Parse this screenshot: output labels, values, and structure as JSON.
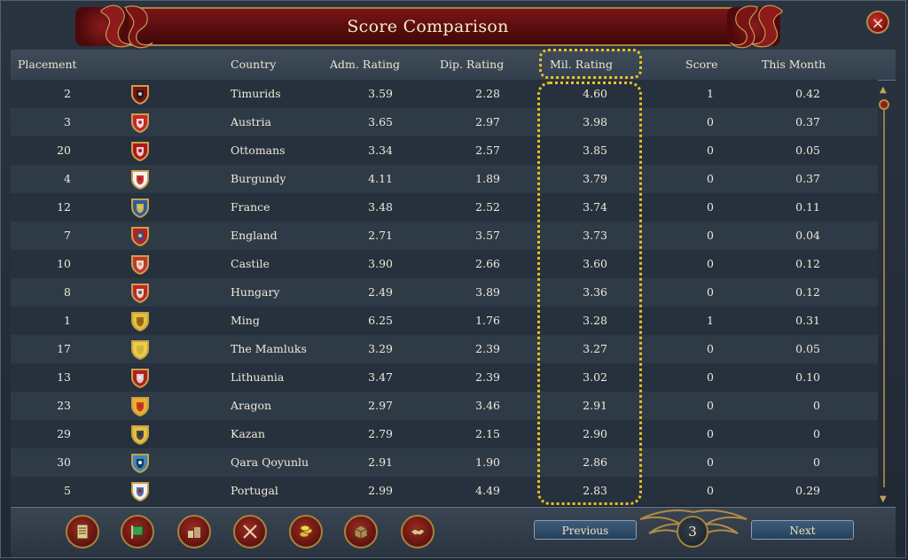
{
  "window": {
    "title": "Score Comparison"
  },
  "columns": {
    "placement": "Placement",
    "country": "Country",
    "adm": "Adm. Rating",
    "dip": "Dip. Rating",
    "mil": "Mil. Rating",
    "score": "Score",
    "month": "This Month"
  },
  "rows": [
    {
      "placement": "2",
      "country": "Timurids",
      "adm": "3.59",
      "dip": "2.28",
      "mil": "4.60",
      "score": "1",
      "month": "0.42",
      "flag": {
        "bg": "#7a1212",
        "fg": "#1a1a1a",
        "mark": "#cccccc"
      }
    },
    {
      "placement": "3",
      "country": "Austria",
      "adm": "3.65",
      "dip": "2.97",
      "mil": "3.98",
      "score": "0",
      "month": "0.37",
      "flag": {
        "bg": "#c8262b",
        "fg": "#ffffff",
        "mark": "#c8262b"
      }
    },
    {
      "placement": "20",
      "country": "Ottomans",
      "adm": "3.34",
      "dip": "2.57",
      "mil": "3.85",
      "score": "0",
      "month": "0.05",
      "flag": {
        "bg": "#b3151a",
        "fg": "#f0f0f0",
        "mark": "#b3151a"
      }
    },
    {
      "placement": "4",
      "country": "Burgundy",
      "adm": "4.11",
      "dip": "1.89",
      "mil": "3.79",
      "score": "0",
      "month": "0.37",
      "flag": {
        "bg": "#f2f2f2",
        "fg": "#c01818",
        "mark": "#c01818"
      }
    },
    {
      "placement": "12",
      "country": "France",
      "adm": "3.48",
      "dip": "2.52",
      "mil": "3.74",
      "score": "0",
      "month": "0.11",
      "flag": {
        "bg": "#2c5aa0",
        "fg": "#e6c34a",
        "mark": "#e6c34a"
      }
    },
    {
      "placement": "7",
      "country": "England",
      "adm": "2.71",
      "dip": "3.57",
      "mil": "3.73",
      "score": "0",
      "month": "0.04",
      "flag": {
        "bg": "#b52222",
        "fg": "#2c4f9e",
        "mark": "#e6c34a"
      }
    },
    {
      "placement": "10",
      "country": "Castile",
      "adm": "3.90",
      "dip": "2.66",
      "mil": "3.60",
      "score": "0",
      "month": "0.12",
      "flag": {
        "bg": "#c2372d",
        "fg": "#f1f1f1",
        "mark": "#d9a330"
      }
    },
    {
      "placement": "8",
      "country": "Hungary",
      "adm": "2.49",
      "dip": "3.89",
      "mil": "3.36",
      "score": "0",
      "month": "0.12",
      "flag": {
        "bg": "#c0282a",
        "fg": "#f5f5f5",
        "mark": "#3f7a3a"
      }
    },
    {
      "placement": "1",
      "country": "Ming",
      "adm": "6.25",
      "dip": "1.76",
      "mil": "3.28",
      "score": "1",
      "month": "0.31",
      "flag": {
        "bg": "#e0c23a",
        "fg": "#8a5a12",
        "mark": "#8a5a12"
      }
    },
    {
      "placement": "17",
      "country": "The Mamluks",
      "adm": "3.29",
      "dip": "2.39",
      "mil": "3.27",
      "score": "0",
      "month": "0.05",
      "flag": {
        "bg": "#e8cf4a",
        "fg": "#d1b236",
        "mark": "#d1b236"
      }
    },
    {
      "placement": "13",
      "country": "Lithuania",
      "adm": "3.47",
      "dip": "2.39",
      "mil": "3.02",
      "score": "0",
      "month": "0.10",
      "flag": {
        "bg": "#b01f22",
        "fg": "#e8e8e8",
        "mark": "#e8e8e8"
      }
    },
    {
      "placement": "23",
      "country": "Aragon",
      "adm": "2.97",
      "dip": "3.46",
      "mil": "2.91",
      "score": "0",
      "month": "0",
      "flag": {
        "bg": "#e7b12f",
        "fg": "#c4261d",
        "mark": "#c4261d"
      }
    },
    {
      "placement": "29",
      "country": "Kazan",
      "adm": "2.79",
      "dip": "2.15",
      "mil": "2.90",
      "score": "0",
      "month": "0",
      "flag": {
        "bg": "#e0c23a",
        "fg": "#2b3050",
        "mark": "#2b3050"
      }
    },
    {
      "placement": "30",
      "country": "Qara Qoyunlu",
      "adm": "2.91",
      "dip": "1.90",
      "mil": "2.86",
      "score": "0",
      "month": "0",
      "flag": {
        "bg": "#3a86c4",
        "fg": "#102a44",
        "mark": "#e9f1f9"
      }
    },
    {
      "placement": "5",
      "country": "Portugal",
      "adm": "2.99",
      "dip": "4.49",
      "mil": "2.83",
      "score": "0",
      "month": "0.29",
      "flag": {
        "bg": "#f2f2f2",
        "fg": "#2c5aa0",
        "mark": "#c01818"
      }
    }
  ],
  "footer": {
    "previous_label": "Previous",
    "next_label": "Next",
    "page_number": "3",
    "tools": [
      "ledger-icon",
      "flag-icon",
      "buildings-icon",
      "crossed-swords-icon",
      "coins-icon",
      "trade-goods-icon",
      "handshake-icon"
    ]
  },
  "highlight": {
    "column": "Mil. Rating",
    "color": "#e9c21f"
  }
}
